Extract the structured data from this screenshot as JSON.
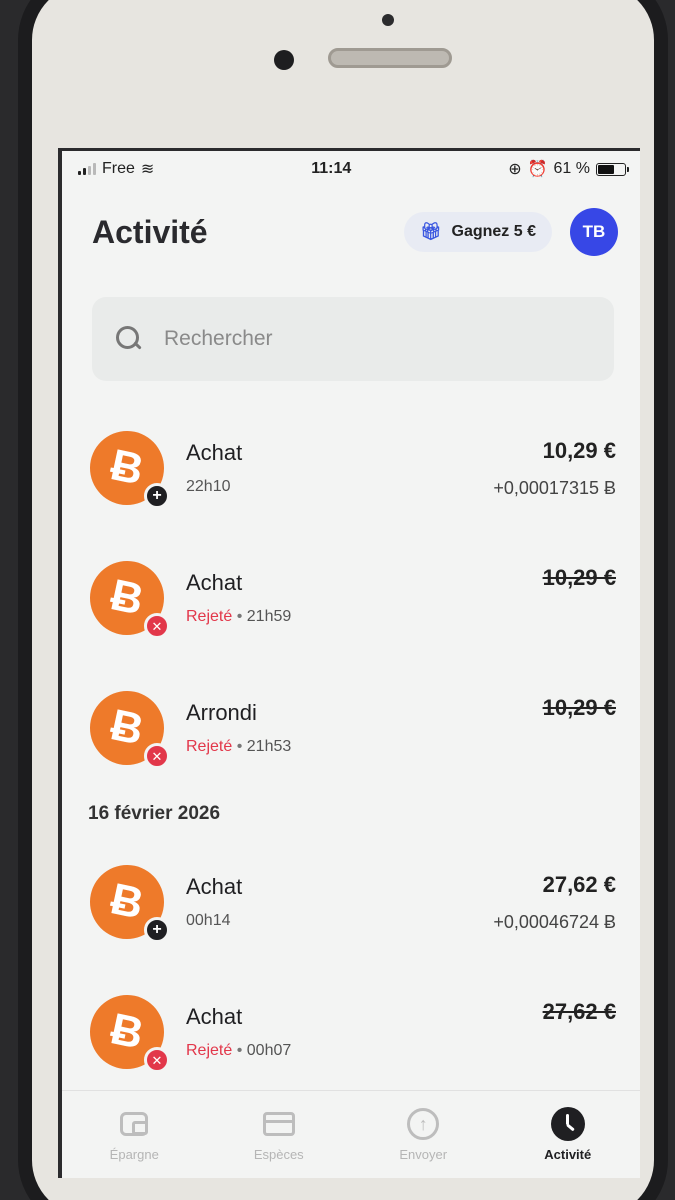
{
  "status": {
    "carrier": "Free",
    "time": "11:14",
    "battery": "61 %"
  },
  "header": {
    "title": "Activité",
    "promo_label": "Gagnez 5 €",
    "avatar_initials": "TB"
  },
  "search": {
    "placeholder": "Rechercher"
  },
  "transactions_today": [
    {
      "title": "Achat",
      "status": "",
      "time": "22h10",
      "amount": "10,29 €",
      "btc": "+0,00017315 Ƀ",
      "badge": "plus"
    },
    {
      "title": "Achat",
      "status": "Rejeté",
      "time": "21h59",
      "amount": "10,29 €",
      "btc": "",
      "badge": "x"
    },
    {
      "title": "Arrondi",
      "status": "Rejeté",
      "time": "21h53",
      "amount": "10,29 €",
      "btc": "",
      "badge": "x"
    }
  ],
  "date_section": "16 février 2026",
  "transactions_feb16": [
    {
      "title": "Achat",
      "status": "",
      "time": "00h14",
      "amount": "27,62 €",
      "btc": "+0,00046724 Ƀ",
      "badge": "plus"
    },
    {
      "title": "Achat",
      "status": "Rejeté",
      "time": "00h07",
      "amount": "27,62 €",
      "btc": "",
      "badge": "x"
    }
  ],
  "separator": "•",
  "coin_symbol": "Ƀ",
  "tabs": [
    {
      "label": "Épargne",
      "icon": "wallet-icon"
    },
    {
      "label": "Espèces",
      "icon": "card-icon"
    },
    {
      "label": "Envoyer",
      "icon": "send-icon"
    },
    {
      "label": "Activité",
      "icon": "clock-icon"
    }
  ],
  "colors": {
    "accent": "#3747e6",
    "bitcoin": "#ee7a2a",
    "rejected": "#e2374a"
  }
}
